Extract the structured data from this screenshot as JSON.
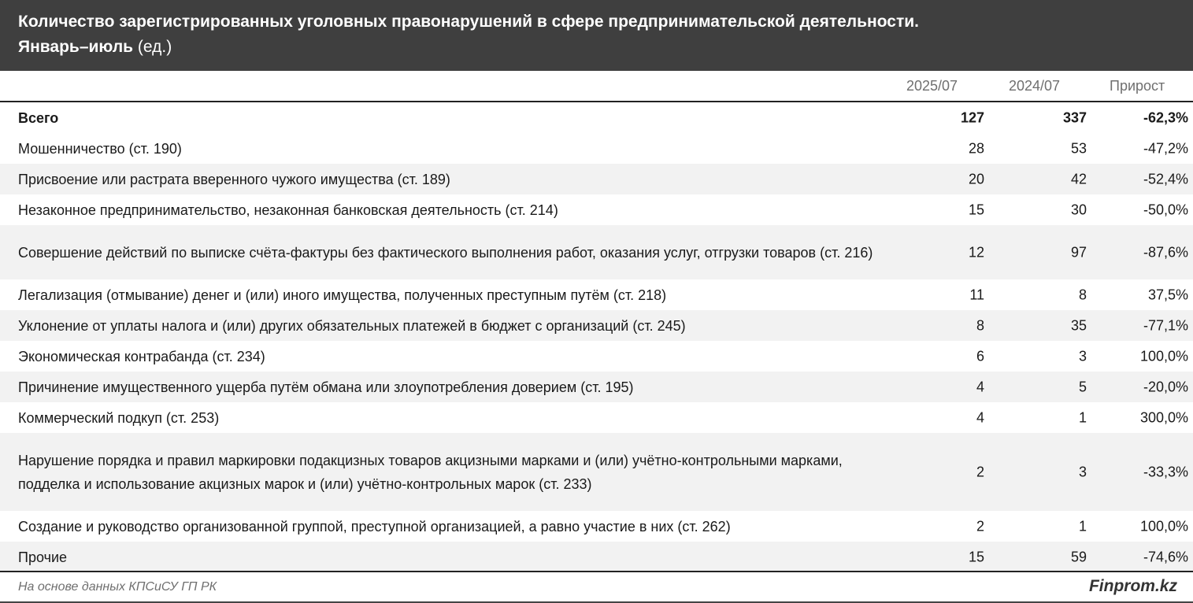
{
  "chart_data": {
    "type": "table",
    "title": "Количество зарегистрированных уголовных правонарушений в сфере предпринимательской деятельности.",
    "subtitle_bold": "Январь–июль",
    "subtitle_rest": " (ед.)",
    "columns": [
      "2025/07",
      "2024/07",
      "Прирост"
    ],
    "rows": [
      {
        "label": "Всего",
        "v2025": "127",
        "v2024": "337",
        "growth": "-62,3%"
      },
      {
        "label": "Мошенничество (ст. 190)",
        "v2025": "28",
        "v2024": "53",
        "growth": "-47,2%"
      },
      {
        "label": "Присвоение или растрата вверенного чужого имущества (ст. 189)",
        "v2025": "20",
        "v2024": "42",
        "growth": "-52,4%"
      },
      {
        "label": "Незаконное предпринимательство, незаконная банковская деятельность (ст. 214)",
        "v2025": "15",
        "v2024": "30",
        "growth": "-50,0%"
      },
      {
        "label": "Совершение действий по выписке счёта-фактуры без фактического выполнения работ, оказания услуг, отгрузки товаров (ст. 216)",
        "v2025": "12",
        "v2024": "97",
        "growth": "-87,6%"
      },
      {
        "label": "Легализация (отмывание) денег и (или) иного имущества, полученных преступным путём (ст. 218)",
        "v2025": "11",
        "v2024": "8",
        "growth": "37,5%"
      },
      {
        "label": "Уклонение от уплаты налога и (или) других обязательных платежей в бюджет с организаций (ст. 245)",
        "v2025": "8",
        "v2024": "35",
        "growth": "-77,1%"
      },
      {
        "label": "Экономическая контрабанда (ст. 234)",
        "v2025": "6",
        "v2024": "3",
        "growth": "100,0%"
      },
      {
        "label": "Причинение имущественного ущерба путём обмана или злоупотребления доверием (ст. 195)",
        "v2025": "4",
        "v2024": "5",
        "growth": "-20,0%"
      },
      {
        "label": "Коммерческий подкуп (ст. 253)",
        "v2025": "4",
        "v2024": "1",
        "growth": "300,0%"
      },
      {
        "label": "Нарушение порядка и правил маркировки подакцизных товаров акцизными марками и (или) учётно-контрольными марками, подделка и использование акцизных марок и (или) учётно-контрольных марок (ст. 233)",
        "v2025": "2",
        "v2024": "3",
        "growth": "-33,3%"
      },
      {
        "label": "Создание и руководство организованной группой, преступной организацией, а равно участие в них (ст. 262)",
        "v2025": "2",
        "v2024": "1",
        "growth": "100,0%"
      },
      {
        "label": "Прочие",
        "v2025": "15",
        "v2024": "59",
        "growth": "-74,6%"
      }
    ]
  },
  "footer": {
    "source": "На основе данных КПСиСУ ГП РК",
    "brand": "Finprom.kz"
  },
  "colors": {
    "header_bg": "#3f3f3f",
    "alt_row_bg": "#f2f2f2",
    "muted_text": "#6f6f6f"
  }
}
